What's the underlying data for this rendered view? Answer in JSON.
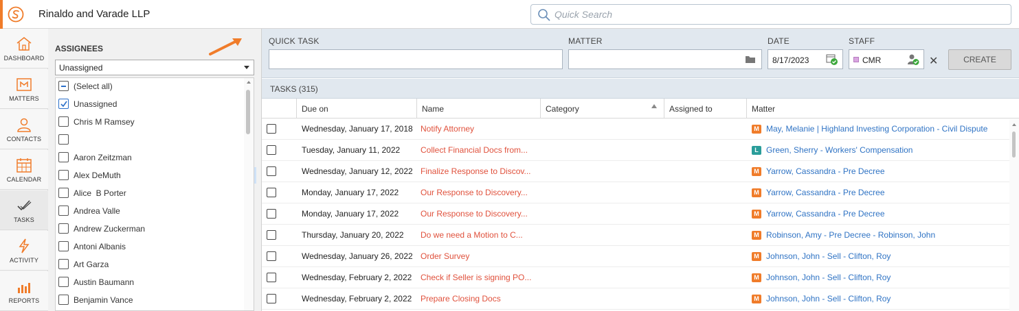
{
  "app": {
    "firm_name": "Rinaldo and Varade LLP",
    "accent_color": "#f07c2a",
    "logo_icon": "rinaldo-logo"
  },
  "search": {
    "placeholder": "Quick Search",
    "icon": "search-icon"
  },
  "nav": {
    "items": [
      {
        "label": "DASHBOARD",
        "icon": "home-icon"
      },
      {
        "label": "MATTERS",
        "icon": "matters-icon"
      },
      {
        "label": "CONTACTS",
        "icon": "contacts-icon"
      },
      {
        "label": "CALENDAR",
        "icon": "calendar-icon"
      },
      {
        "label": "TASKS",
        "icon": "tasks-icon",
        "active": true
      },
      {
        "label": "ACTIVITY",
        "icon": "lightning-icon"
      },
      {
        "label": "REPORTS",
        "icon": "bar-chart-icon"
      }
    ]
  },
  "assignees": {
    "title": "ASSIGNEES",
    "filter_value": "Unassigned",
    "items": [
      {
        "label": "(Select all)",
        "state": "partial"
      },
      {
        "label": "Unassigned",
        "state": "checked"
      },
      {
        "label": "Chris M Ramsey",
        "state": "unchecked"
      },
      {
        "label": "",
        "state": "unchecked"
      },
      {
        "label": "Aaron Zeitzman",
        "state": "unchecked"
      },
      {
        "label": "Alex DeMuth",
        "state": "unchecked"
      },
      {
        "label": "Alice  B Porter",
        "state": "unchecked"
      },
      {
        "label": "Andrea Valle",
        "state": "unchecked"
      },
      {
        "label": "Andrew Zuckerman",
        "state": "unchecked"
      },
      {
        "label": "Antoni Albanis",
        "state": "unchecked"
      },
      {
        "label": "Art Garza",
        "state": "unchecked"
      },
      {
        "label": "Austin Baumann",
        "state": "unchecked"
      },
      {
        "label": "Benjamin Vance",
        "state": "unchecked"
      }
    ]
  },
  "quick_task": {
    "quick_task_label": "QUICK TASK",
    "quick_task_value": "",
    "matter_label": "MATTER",
    "matter_value": "",
    "date_label": "DATE",
    "date_value": "8/17/2023",
    "staff_label": "STAFF",
    "staff_value": "CMR",
    "staff_color": "#d9a6e0",
    "create_label": "CREATE",
    "clear_symbol": "✕"
  },
  "tasks": {
    "header": "TASKS (315)",
    "columns": {
      "due": "Due on",
      "name": "Name",
      "category": "Category",
      "assigned": "Assigned to",
      "matter": "Matter"
    },
    "rows": [
      {
        "due": "Wednesday, January 17, 2018",
        "name": "Notify Attorney",
        "matter_type": "M",
        "matter": "May, Melanie | Highland Investing Corporation - Civil Dispute"
      },
      {
        "due": "Tuesday, January 11, 2022",
        "name": "Collect Financial Docs from...",
        "matter_type": "L",
        "matter": "Green, Sherry - Workers' Compensation"
      },
      {
        "due": "Wednesday, January 12, 2022",
        "name": "Finalize Response to Discov...",
        "matter_type": "M",
        "matter": "Yarrow, Cassandra - Pre Decree"
      },
      {
        "due": "Monday, January 17, 2022",
        "name": "Our Response to Discovery...",
        "matter_type": "M",
        "matter": "Yarrow, Cassandra - Pre Decree"
      },
      {
        "due": "Monday, January 17, 2022",
        "name": "Our Response to Discovery...",
        "matter_type": "M",
        "matter": "Yarrow, Cassandra - Pre Decree"
      },
      {
        "due": "Thursday, January 20, 2022",
        "name": "Do we need a Motion to C...",
        "matter_type": "M",
        "matter": "Robinson, Amy - Pre Decree - Robinson, John"
      },
      {
        "due": "Wednesday, January 26, 2022",
        "name": "Order Survey",
        "matter_type": "M",
        "matter": "Johnson, John - Sell - Clifton, Roy"
      },
      {
        "due": "Wednesday, February 2, 2022",
        "name": "Check if Seller is signing PO...",
        "matter_type": "M",
        "matter": "Johnson, John - Sell - Clifton, Roy"
      },
      {
        "due": "Wednesday, February 2, 2022",
        "name": "Prepare Closing Docs",
        "matter_type": "M",
        "matter": "Johnson, John - Sell - Clifton, Roy"
      }
    ]
  }
}
